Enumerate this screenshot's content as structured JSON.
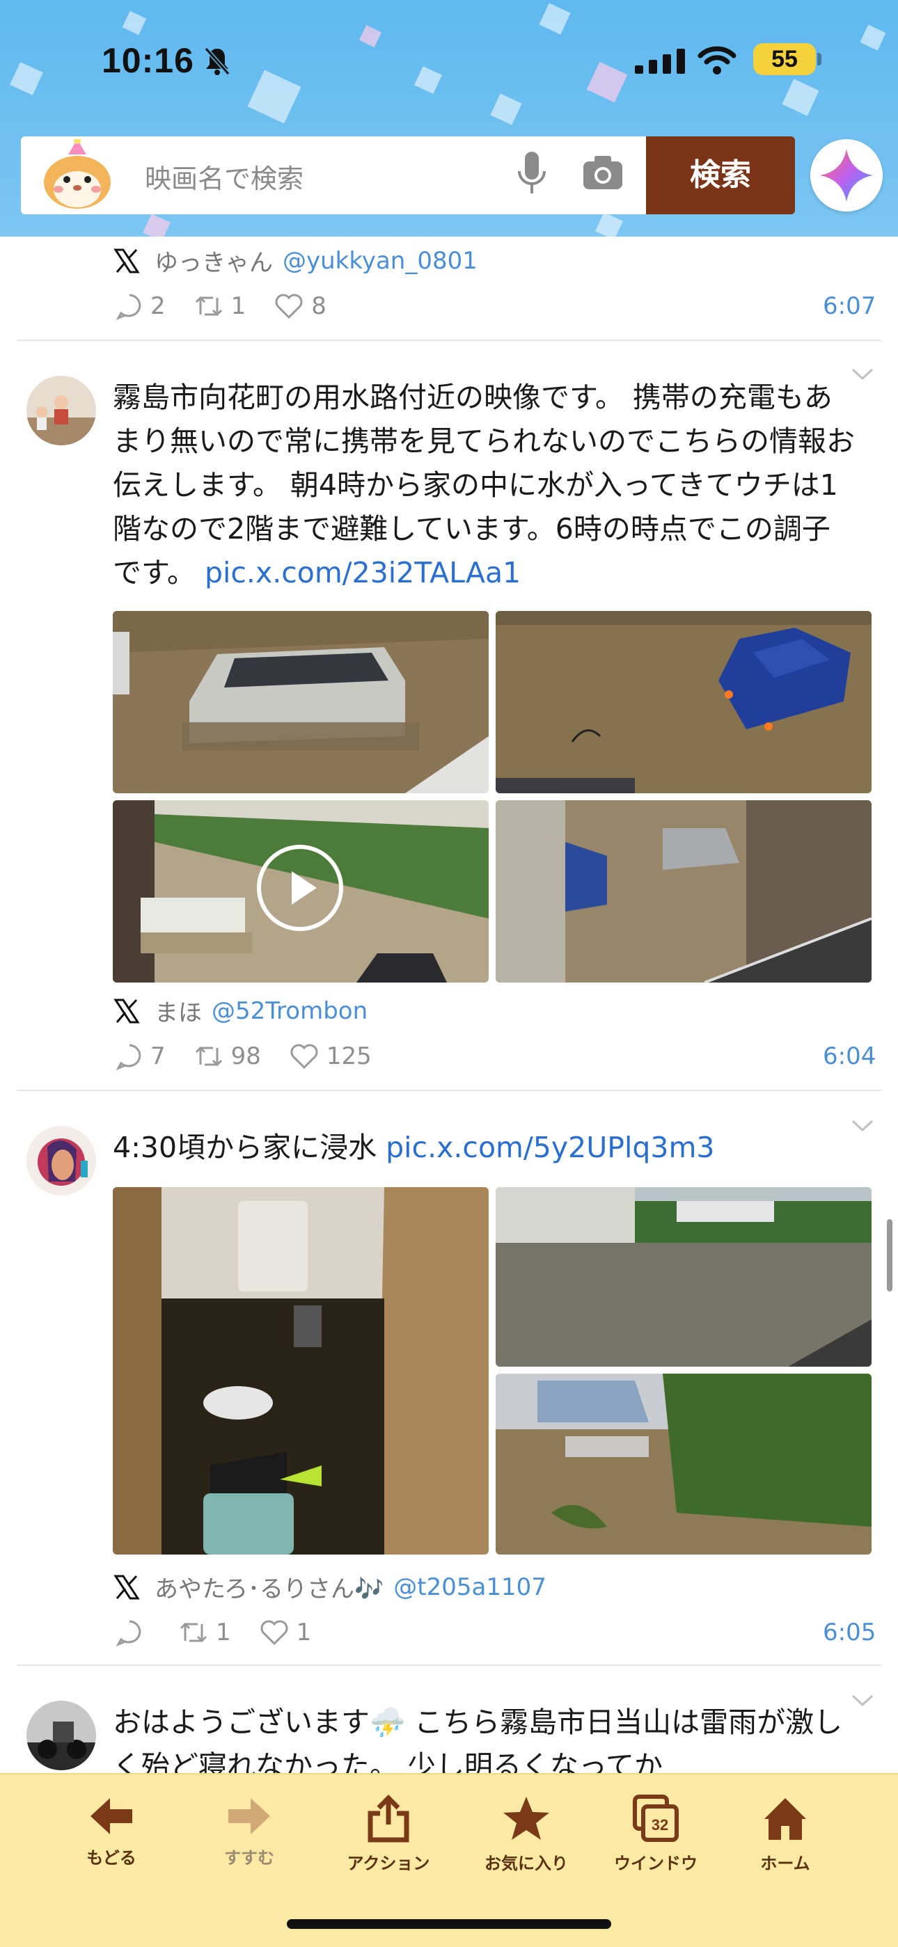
{
  "status_bar": {
    "time": "10:16",
    "battery": "55"
  },
  "search": {
    "placeholder": "映画名で検索",
    "button_label": "検索"
  },
  "posts": [
    {
      "author_name": "ゆっきゃん",
      "author_handle": "@yukkyan_0801",
      "replies": "2",
      "reposts": "1",
      "likes": "8",
      "time": "6:07"
    },
    {
      "text": "霧島市向花町の用水路付近の映像です。 携帯の充電もあまり無いので常に携帯を見てられないのでこちらの情報お伝えします。 朝4時から家の中に水が入ってきてウチは1階なので2階まで避難しています。6時の時点でこの調子です。",
      "link": "pic.x.com/23i2TALAa1",
      "author_name": "まほ",
      "author_handle": "@52Trombon",
      "replies": "7",
      "reposts": "98",
      "likes": "125",
      "time": "6:04"
    },
    {
      "text": "4:30頃から家に浸水",
      "link": "pic.x.com/5y2UPlq3m3",
      "author_name": "あやたろ･るりさん🎶",
      "author_handle": "@t205a1107",
      "replies": "",
      "reposts": "1",
      "likes": "1",
      "time": "6:05"
    },
    {
      "text": "おはようございます⛈️ こちら霧島市日当山は雷雨が激しく殆ど寝れなかった。 少し明るくなってか"
    }
  ],
  "toolbar": {
    "items": [
      {
        "label": "もどる",
        "icon": "arrow-left-icon"
      },
      {
        "label": "すすむ",
        "icon": "arrow-right-icon"
      },
      {
        "label": "アクション",
        "icon": "share-icon"
      },
      {
        "label": "お気に入り",
        "icon": "star-icon"
      },
      {
        "label": "ウインドウ",
        "icon": "windows-icon",
        "count": "32"
      },
      {
        "label": "ホーム",
        "icon": "home-icon"
      }
    ]
  },
  "colors": {
    "header": "#5fb8ef",
    "search_button": "#7a3417",
    "link": "#2a6fd0",
    "toolbar": "#fbe9a4"
  }
}
